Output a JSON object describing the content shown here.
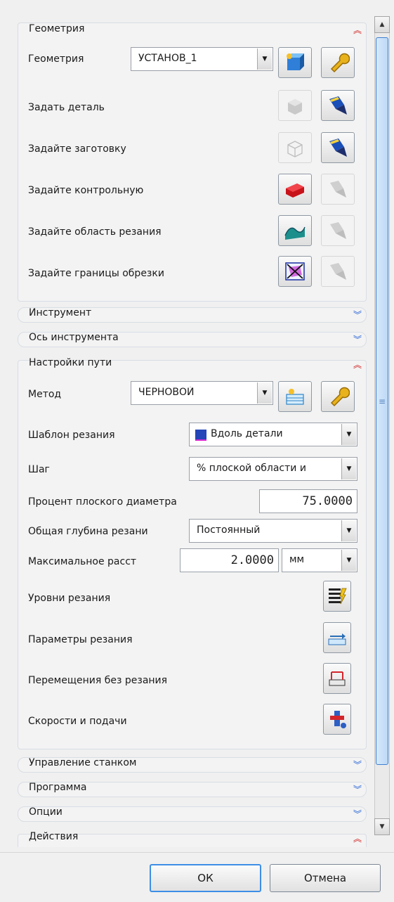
{
  "sections": {
    "geometry": {
      "title": "Геометрия",
      "geometry_label": "Геометрия",
      "geometry_value": "УСТАНОВ_1",
      "rows": [
        {
          "label": "Задать деталь"
        },
        {
          "label": "Задайте заготовку"
        },
        {
          "label": "Задайте контрольную"
        },
        {
          "label": "Задайте область резания"
        },
        {
          "label": "Задайте границы обрезки"
        }
      ]
    },
    "tool": {
      "title": "Инструмент"
    },
    "tool_axis": {
      "title": "Ось инструмента"
    },
    "path_settings": {
      "title": "Настройки пути",
      "method_label": "Метод",
      "method_value": "ЧЕРНОВОЙ",
      "cut_pattern_label": "Шаблон резания",
      "cut_pattern_value": "Вдоль детали",
      "step_label": "Шаг",
      "step_value": "% плоской области и",
      "flat_percent_label": "Процент плоского диаметра",
      "flat_percent_value": "75.0000",
      "total_depth_label": "Общая глубина резани",
      "total_depth_value": "Постоянный",
      "max_dist_label": "Максимальное расст",
      "max_dist_value": "2.0000",
      "max_dist_unit": "мм",
      "cut_levels_label": "Уровни резания",
      "cut_params_label": "Параметры резания",
      "non_cut_moves_label": "Перемещения без резания",
      "feeds_speeds_label": "Скорости и подачи"
    },
    "machine_control": {
      "title": "Управление станком"
    },
    "program": {
      "title": "Программа"
    },
    "options": {
      "title": "Опции"
    },
    "actions": {
      "title": "Действия"
    }
  },
  "footer": {
    "ok_label": "ОК",
    "cancel_label": "Отмена"
  },
  "icons": {
    "geometry_new": "new-geometry-icon",
    "geometry_edit": "wrench-icon",
    "select": "flashlight-icon",
    "display": "display-geometry-icon"
  },
  "colors": {
    "expand": "#1f5fd6",
    "collapse": "#d01b1b",
    "focus_border": "#3d8ee6"
  }
}
